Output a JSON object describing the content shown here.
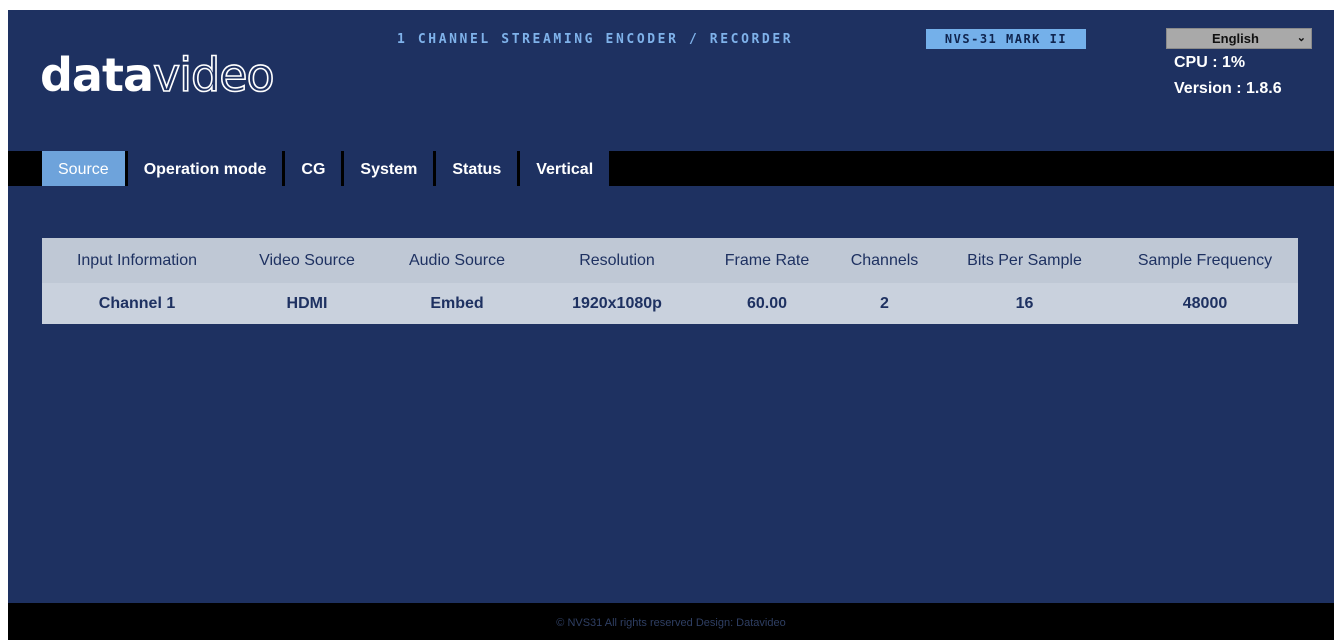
{
  "header": {
    "logo": {
      "bold_part": "data",
      "thin_part": "video"
    },
    "product_title": "1 CHANNEL STREAMING ENCODER / RECORDER",
    "model_badge": "NVS-31 MARK II",
    "language": {
      "selected": "English",
      "icon": "chevron-down-icon"
    },
    "cpu": "CPU  : 1%",
    "version": "Version : 1.8.6"
  },
  "tabs": [
    {
      "label": "Source",
      "active": true
    },
    {
      "label": "Operation mode",
      "active": false
    },
    {
      "label": "CG",
      "active": false
    },
    {
      "label": "System",
      "active": false
    },
    {
      "label": "Status",
      "active": false
    },
    {
      "label": "Vertical",
      "active": false
    }
  ],
  "source_table": {
    "columns": [
      "Input Information",
      "Video Source",
      "Audio Source",
      "Resolution",
      "Frame Rate",
      "Channels",
      "Bits Per Sample",
      "Sample Frequency"
    ],
    "rows": [
      [
        "Channel 1",
        "HDMI",
        "Embed",
        "1920x1080p",
        "60.00",
        "2",
        "16",
        "48000"
      ]
    ]
  },
  "footer": {
    "text": "© NVS31 All rights reserved Design: Datavideo"
  },
  "colors": {
    "background": "#1e3161",
    "accent": "#6ea3db",
    "title": "#7fb2ea",
    "table_header": "#bfc8d5",
    "table_row": "#c9d1dd"
  }
}
